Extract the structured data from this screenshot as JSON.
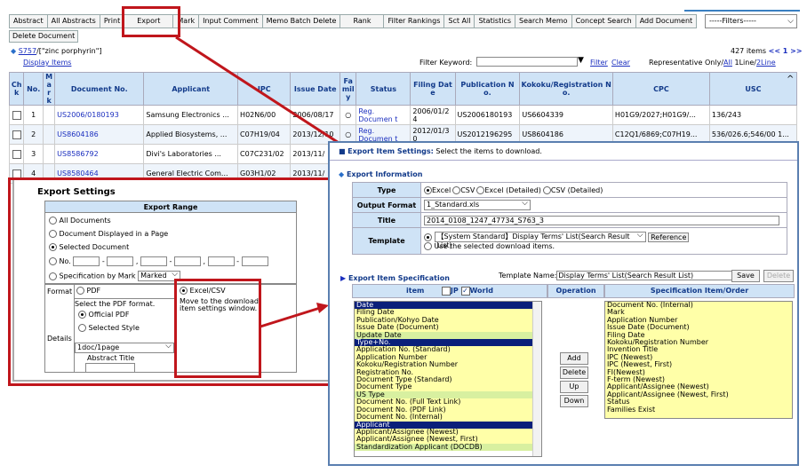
{
  "toolbar": {
    "buttons": [
      "Abstract",
      "All Abstracts",
      "Print",
      "Export",
      "Mark",
      "Input Comment",
      "Memo Batch Delete",
      "Rank",
      "Filter Rankings",
      "Sct All",
      "Statistics",
      "Search Memo",
      "Concept Search",
      "Add Document"
    ],
    "filters": "-----Filters-----",
    "delete_document": "Delete Document"
  },
  "query": {
    "link": "S757",
    "text": "/[\"zinc porphyrin\"]",
    "display_items": "Display Items",
    "filter_keyword": "Filter Keyword:",
    "filter": "Filter",
    "clear": "Clear",
    "count": "427 items",
    "nav": "<< 1 >>",
    "rep_only": "Representative Only/",
    "all": "All",
    "line1": "1Line/",
    "line2": "2Line"
  },
  "table": {
    "headers": [
      "Ch k",
      "No.",
      "M a r k",
      "Document No.",
      "Applicant",
      "IPC",
      "Issue Date",
      "Fa mil y",
      "Status",
      "Filing Dat e",
      "Publication N o.",
      "Kokoku/Registration N o.",
      "CPC",
      "USC"
    ],
    "rows": [
      [
        "1",
        "US2006/0180193",
        "Samsung Electronics ...",
        "H02N6/00",
        "2006/08/17",
        "○",
        "Reg. Documen t",
        "2006/01/2 4",
        "US2006180193",
        "US6604339",
        "H01G9/2027;H01G9/...",
        "136/243"
      ],
      [
        "2",
        "US8604186",
        "Applied Biosystems, ...",
        "C07H19/04",
        "2013/12/10",
        "○",
        "Reg. Documen t",
        "2012/01/3 0",
        "US2012196295",
        "US8604186",
        "C12Q1/6869;C07H19...",
        "536/026.6;546/00 1..."
      ],
      [
        "3",
        "US8586792",
        "Divi's Laboratories ...",
        "C07C231/02",
        "2013/11/",
        "",
        "",
        "",
        "",
        "",
        "",
        ""
      ],
      [
        "4",
        "US8580464",
        "General Electric Com...",
        "G03H1/02",
        "2013/11/",
        "",
        "",
        "",
        "",
        "",
        "",
        ""
      ]
    ]
  },
  "export_settings": {
    "title": "Export Settings",
    "range_header": "Export Range",
    "all_documents": "All Documents",
    "displayed_page": "Document Displayed in a Page",
    "selected_document": "Selected Document",
    "no": "No.",
    "by_mark": "Specification by Mark",
    "marked": "Marked",
    "format": "Format",
    "pdf": "PDF",
    "excel_csv": "Excel/CSV",
    "excel_note": "Move to the download item settings window.",
    "details": "Details",
    "select_pdf": "Select the PDF format.",
    "official_pdf": "Official PDF",
    "selected_style": "Selected Style",
    "pages": "1doc/1page",
    "abstract_title": "Abstract Title"
  },
  "dialog": {
    "title": "Export Item Settings:",
    "title_note": "Select the items to download.",
    "export_info": "Export Information",
    "type_label": "Type",
    "types": [
      "Excel",
      "CSV",
      "Excel (Detailed)",
      "CSV (Detailed)"
    ],
    "output_format_label": "Output Format",
    "output_format": "1_Standard.xls",
    "title_label": "Title",
    "title_value": "2014_0108_1247_47734_S763_3",
    "template_label": "Template",
    "template_value": "【System Standard】Display Terms' List(Search Result List)",
    "reference": "Reference",
    "use_selected": "Use the selected download items.",
    "spec_title": "Export Item Specification",
    "template_name_label": "Template Name:",
    "template_name": "Display Terms' List(Search Result List)",
    "save": "Save",
    "delete": "Delete",
    "col_item": "item",
    "jp": "JP",
    "world": "World",
    "col_operation": "Operation",
    "col_spec": "Specification Item/Order",
    "items": [
      [
        "Date",
        "s"
      ],
      [
        "Filing Date",
        "y"
      ],
      [
        "Publication/Kohyo Date",
        "y"
      ],
      [
        "Issue Date (Document)",
        "y"
      ],
      [
        "Update Date",
        "g"
      ],
      [
        "Type+No.",
        "s"
      ],
      [
        "Application No. (Standard)",
        "y"
      ],
      [
        "Application Number",
        "y"
      ],
      [
        "Kokoku/Registration Number",
        "y"
      ],
      [
        "Registration No.",
        "y"
      ],
      [
        "Document Type (Standard)",
        "y"
      ],
      [
        "Document Type",
        "y"
      ],
      [
        "US Type",
        "g"
      ],
      [
        "Document No. (Full Text Link)",
        "y"
      ],
      [
        "Document No. (PDF Link)",
        "y"
      ],
      [
        "Document No. (Internal)",
        "y"
      ],
      [
        "Applicant",
        "s"
      ],
      [
        "Applicant/Assignee (Newest)",
        "y"
      ],
      [
        "Applicant/Assignee (Newest, First)",
        "y"
      ],
      [
        "Standardization Applicant (DOCDB)",
        "g"
      ]
    ],
    "ops": [
      "Add",
      "Delete",
      "Up",
      "Down"
    ],
    "spec_items": [
      "Document No. (Internal)",
      "Mark",
      "Application Number",
      "Issue Date (Document)",
      "Filing Date",
      "Kokoku/Registration Number",
      "Invention Title",
      "IPC (Newest)",
      "IPC (Newest, First)",
      "FI(Newest)",
      "F-term (Newest)",
      "Applicant/Assignee (Newest)",
      "Applicant/Assignee (Newest, First)",
      "Status",
      "Families Exist"
    ]
  },
  "colors": {
    "header_blue": "#cfe3f6",
    "highlight": "#c0161c",
    "selected": "#0a1f7a"
  }
}
